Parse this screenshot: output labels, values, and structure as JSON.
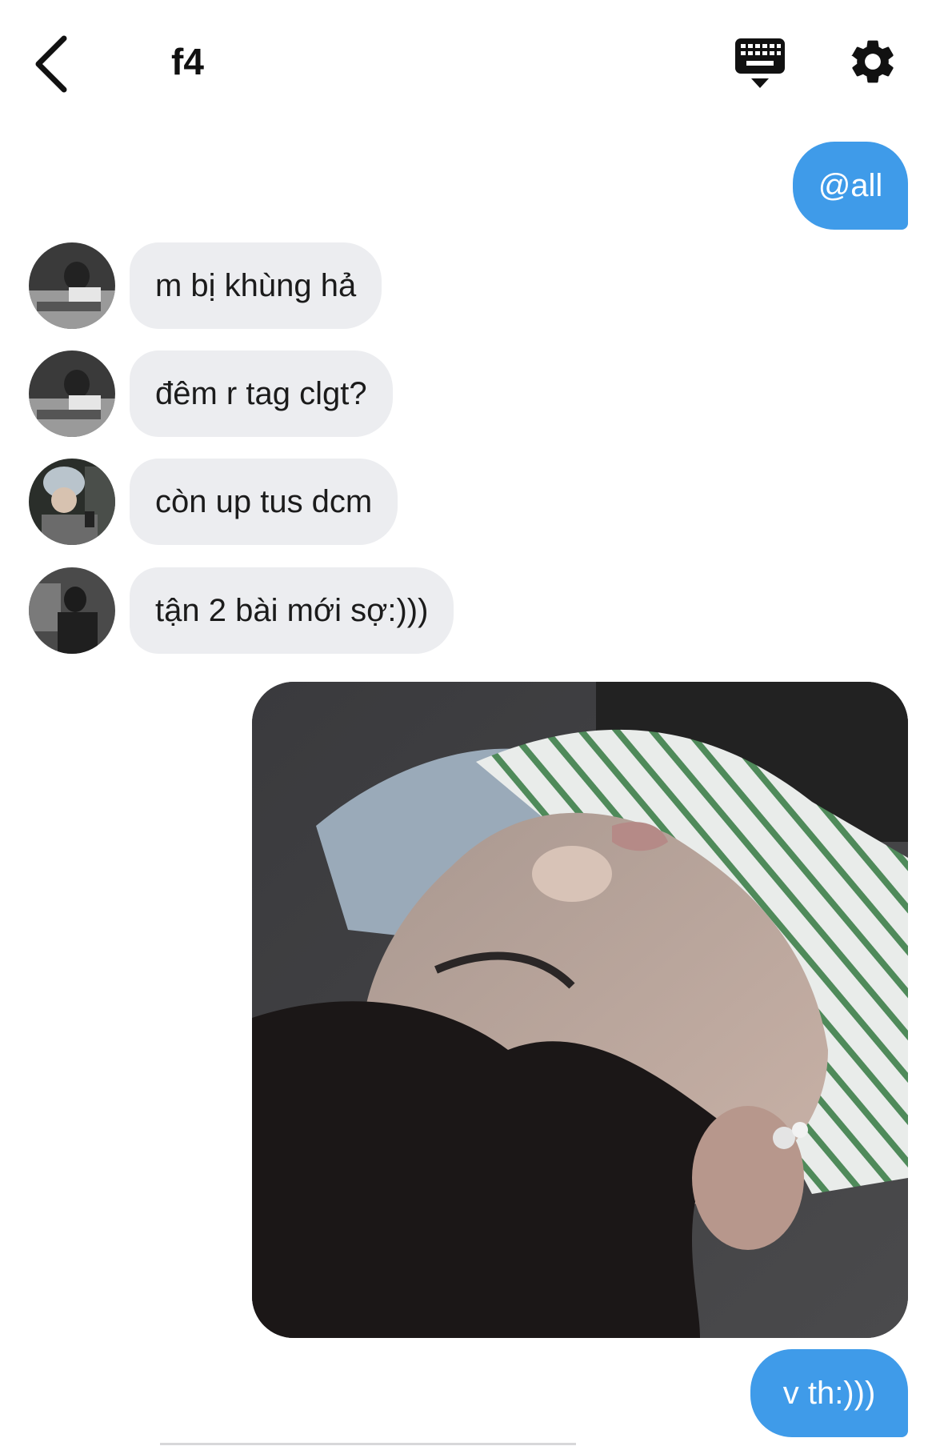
{
  "header": {
    "title": "f4"
  },
  "messages": [
    {
      "text": "@all",
      "direction": "out"
    },
    {
      "text": "m bị khùng hả",
      "direction": "in"
    },
    {
      "text": "đêm r tag clgt?",
      "direction": "in"
    },
    {
      "text": "còn up tus dcm",
      "direction": "in"
    },
    {
      "text": "tận 2 bài mới sợ:)))",
      "direction": "in"
    },
    {
      "text": "v th:)))",
      "direction": "out"
    }
  ],
  "colors": {
    "outgoing_bubble": "#3f9be9",
    "incoming_bubble": "#ecedf0",
    "text_dark": "#1b1b1b"
  },
  "icons": {
    "back": "chevron-left-icon",
    "keyboard": "keyboard-icon",
    "settings": "gear-icon"
  }
}
